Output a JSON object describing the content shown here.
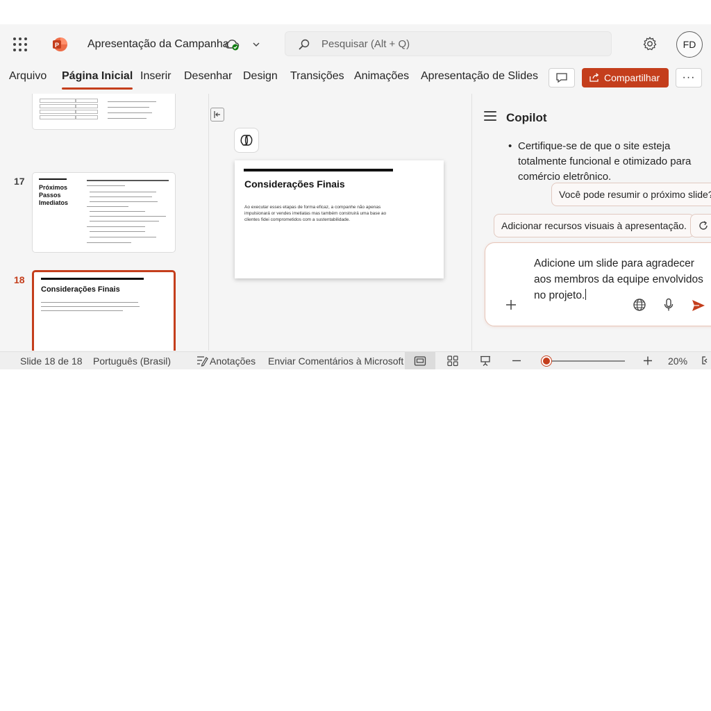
{
  "titlebar": {
    "document_title": "Apresentação da Campanha",
    "search_placeholder": "Pesquisar (Alt + Q)",
    "avatar_initials": "FD",
    "app_icon": "powerpoint-logo-icon"
  },
  "ribbon": {
    "tabs": [
      {
        "label": "Arquivo",
        "active": false
      },
      {
        "label": "Página Inicial",
        "active": true
      },
      {
        "label": "Inserir",
        "active": false
      },
      {
        "label": "Desenhar",
        "active": false
      },
      {
        "label": "Design",
        "active": false
      },
      {
        "label": "Transições",
        "active": false
      },
      {
        "label": "Animações",
        "active": false
      },
      {
        "label": "Apresentação de Slides",
        "active": false
      }
    ],
    "share_label": "Compartilhar",
    "more_label": "···"
  },
  "thumbnails": {
    "items": [
      {
        "number": "17",
        "title": "Próximos Passos Imediatos"
      },
      {
        "number": "18",
        "title": "Considerações Finais",
        "selected": true
      }
    ]
  },
  "slide": {
    "title": "Considerações Finais",
    "body": "Ao executar esses etapas de forma eficaz, a companhe não apenas impulsionará or vendes imetiatas mas também construirá uma base ao clientes fidei comprometidos com a sustentabilidade."
  },
  "copilot": {
    "title": "Copilot",
    "bullet": "Certifique-se de que o site esteja totalmente funcional e otimizado para comércio eletrônico.",
    "user_prompt": "Você pode resumir o próximo slide?",
    "suggestion": "Adicionar recursos visuais à apresentação.",
    "compose_text": "Adicione um slide para agradecer aos membros da equipe envolvidos no projeto."
  },
  "statusbar": {
    "slide_counter": "Slide 18 de 18",
    "language": "Português (Brasil)",
    "notes_label": "Anotações",
    "feedback_label": "Enviar Comentários à Microsoft",
    "zoom_level": "20%",
    "zoom_fraction": 0.04
  },
  "colors": {
    "accent": "#c43e1c",
    "background": "#f5f5f5"
  }
}
